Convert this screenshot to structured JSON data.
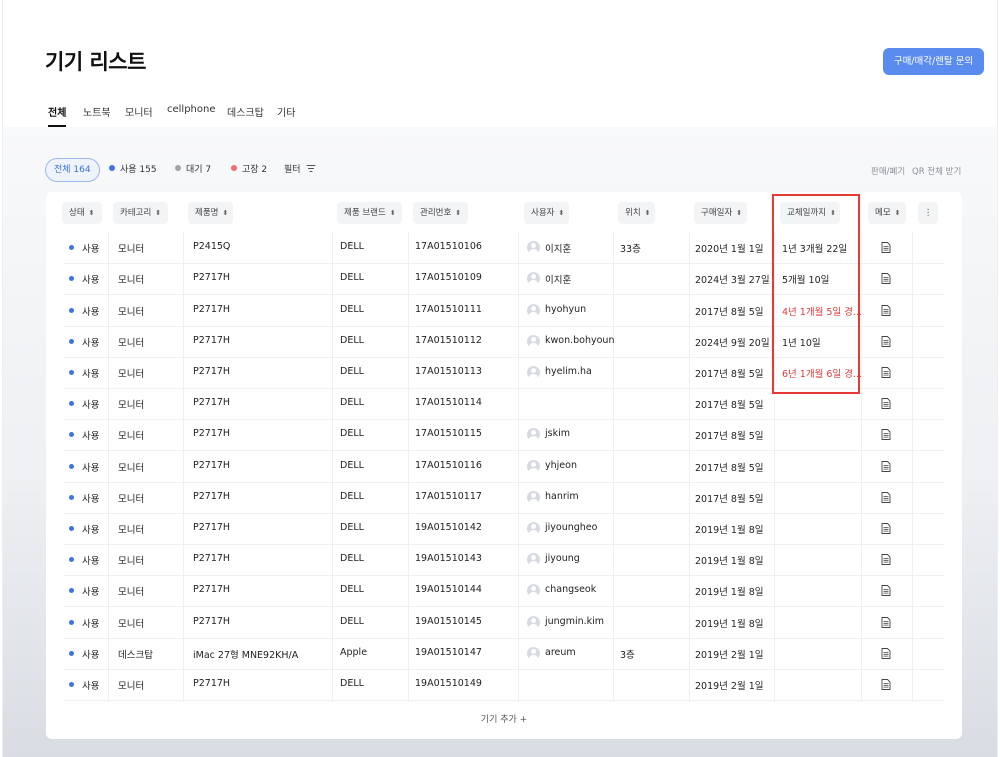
{
  "page": {
    "title": "기기 리스트",
    "inquiry_button": "구매/매각/렌탈 문의"
  },
  "tabs": [
    "전체",
    "노트북",
    "모니터",
    "cellphone",
    "데스크탑",
    "기타"
  ],
  "filters": {
    "all": "전체 164",
    "in_use": "사용 155",
    "standby": "대기 7",
    "broken": "고장 2",
    "filter_label": "필터",
    "filter_icon": "filter-icon"
  },
  "actions": {
    "sell_dispose": "판매/폐기",
    "qr_all": "QR 전체 받기"
  },
  "table": {
    "headers": {
      "status": "상태",
      "category": "카테고리",
      "product": "제품명",
      "brand": "제품 브랜드",
      "asset_no": "관리번호",
      "user": "사용자",
      "location": "위치",
      "purchase_date": "구매일자",
      "replace_until": "교체일까지",
      "memo": "메모"
    },
    "rows": [
      {
        "status": "사용",
        "category": "모니터",
        "product": "P2415Q",
        "brand": "DELL",
        "asset_no": "17A01510106",
        "user": "이지훈",
        "location": "33층",
        "purchase_date": "2020년 1월 1일",
        "replace_until": "1년 3개월 22일",
        "warn": false
      },
      {
        "status": "사용",
        "category": "모니터",
        "product": "P2717H",
        "brand": "DELL",
        "asset_no": "17A01510109",
        "user": "이지훈",
        "location": "",
        "purchase_date": "2024년 3월 27일",
        "replace_until": "5개월 10일",
        "warn": false
      },
      {
        "status": "사용",
        "category": "모니터",
        "product": "P2717H",
        "brand": "DELL",
        "asset_no": "17A01510111",
        "user": "hyohyun",
        "location": "",
        "purchase_date": "2017년 8월 5일",
        "replace_until": "4년 1개월 5일 경...",
        "warn": true
      },
      {
        "status": "사용",
        "category": "모니터",
        "product": "P2717H",
        "brand": "DELL",
        "asset_no": "17A01510112",
        "user": "kwon.bohyoun",
        "location": "",
        "purchase_date": "2024년 9월 20일",
        "replace_until": "1년 10일",
        "warn": false
      },
      {
        "status": "사용",
        "category": "모니터",
        "product": "P2717H",
        "brand": "DELL",
        "asset_no": "17A01510113",
        "user": "hyelim.ha",
        "location": "",
        "purchase_date": "2017년 8월 5일",
        "replace_until": "6년 1개월 6일 경...",
        "warn": true
      },
      {
        "status": "사용",
        "category": "모니터",
        "product": "P2717H",
        "brand": "DELL",
        "asset_no": "17A01510114",
        "user": "",
        "location": "",
        "purchase_date": "2017년 8월 5일",
        "replace_until": "",
        "warn": false
      },
      {
        "status": "사용",
        "category": "모니터",
        "product": "P2717H",
        "brand": "DELL",
        "asset_no": "17A01510115",
        "user": "jskim",
        "location": "",
        "purchase_date": "2017년 8월 5일",
        "replace_until": "",
        "warn": false
      },
      {
        "status": "사용",
        "category": "모니터",
        "product": "P2717H",
        "brand": "DELL",
        "asset_no": "17A01510116",
        "user": "yhjeon",
        "location": "",
        "purchase_date": "2017년 8월 5일",
        "replace_until": "",
        "warn": false
      },
      {
        "status": "사용",
        "category": "모니터",
        "product": "P2717H",
        "brand": "DELL",
        "asset_no": "17A01510117",
        "user": "hanrim",
        "location": "",
        "purchase_date": "2017년 8월 5일",
        "replace_until": "",
        "warn": false
      },
      {
        "status": "사용",
        "category": "모니터",
        "product": "P2717H",
        "brand": "DELL",
        "asset_no": "19A01510142",
        "user": "jiyoungheo",
        "location": "",
        "purchase_date": "2019년 1월 8일",
        "replace_until": "",
        "warn": false
      },
      {
        "status": "사용",
        "category": "모니터",
        "product": "P2717H",
        "brand": "DELL",
        "asset_no": "19A01510143",
        "user": "jiyoung",
        "location": "",
        "purchase_date": "2019년 1월 8일",
        "replace_until": "",
        "warn": false
      },
      {
        "status": "사용",
        "category": "모니터",
        "product": "P2717H",
        "brand": "DELL",
        "asset_no": "19A01510144",
        "user": "changseok",
        "location": "",
        "purchase_date": "2019년 1월 8일",
        "replace_until": "",
        "warn": false
      },
      {
        "status": "사용",
        "category": "모니터",
        "product": "P2717H",
        "brand": "DELL",
        "asset_no": "19A01510145",
        "user": "jungmin.kim",
        "location": "",
        "purchase_date": "2019년 1월 8일",
        "replace_until": "",
        "warn": false
      },
      {
        "status": "사용",
        "category": "데스크탑",
        "product": "iMac 27형 MNE92KH/A",
        "brand": "Apple",
        "asset_no": "19A01510147",
        "user": "areum",
        "location": "3층",
        "purchase_date": "2019년 2월 1일",
        "replace_until": "",
        "warn": false
      },
      {
        "status": "사용",
        "category": "모니터",
        "product": "P2717H",
        "brand": "DELL",
        "asset_no": "19A01510149",
        "user": "",
        "location": "",
        "purchase_date": "2019년 2월 1일",
        "replace_until": "",
        "warn": false
      }
    ],
    "add_label": "기기 추가 +"
  },
  "colors": {
    "accent": "#5a8cf0",
    "status_in_use": "#3f74e0",
    "status_standby": "#a0a4ab",
    "status_broken": "#f26d6d",
    "warning_text": "#e03a3a",
    "highlight_box": "#e53935"
  },
  "icons": {
    "memo": "document-icon",
    "column_menu": "more-vertical-icon",
    "sort": "sort-arrows-icon",
    "user": "avatar-icon"
  }
}
